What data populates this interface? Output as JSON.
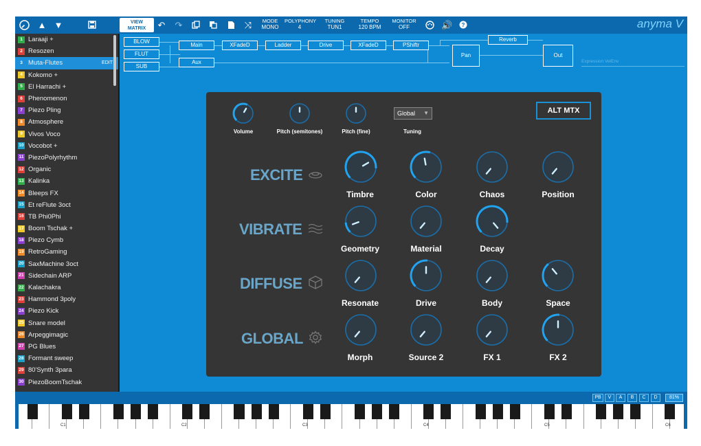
{
  "topbar": {
    "view_matrix_line1": "VIEW",
    "view_matrix_line2": "MATRIX",
    "mode_label": "MODE",
    "mode_value": "MONO",
    "polyphony_label": "POLYPHONY",
    "polyphony_value": "4",
    "tuning_label": "TUNING",
    "tuning_value": "TUN1",
    "tempo_label": "TEMPO",
    "tempo_value": "120 BPM",
    "monitor_label": "MONITOR",
    "monitor_value": "OFF",
    "logo": "anyma V"
  },
  "presets": [
    {
      "num": "1",
      "name": "Laraaji +",
      "color": "#2fae4a"
    },
    {
      "num": "2",
      "name": "Resozen",
      "color": "#e0403a"
    },
    {
      "num": "3",
      "name": "Muta-Flutes",
      "color": "#1e8fd8",
      "selected": true,
      "edit": "EDIT"
    },
    {
      "num": "4",
      "name": "Kokomo +",
      "color": "#f0c828"
    },
    {
      "num": "5",
      "name": "El Harrachi +",
      "color": "#2fae4a"
    },
    {
      "num": "6",
      "name": "Phenomenon",
      "color": "#e0403a"
    },
    {
      "num": "7",
      "name": "Piezo Pling",
      "color": "#8a3fd0"
    },
    {
      "num": "8",
      "name": "Atmosphere",
      "color": "#f08a28"
    },
    {
      "num": "9",
      "name": "Vivos Voco",
      "color": "#f0c828"
    },
    {
      "num": "10",
      "name": "Vocobot +",
      "color": "#1aa0c8"
    },
    {
      "num": "11",
      "name": "PiezoPolyrhythm",
      "color": "#8a3fd0"
    },
    {
      "num": "12",
      "name": "Organic",
      "color": "#e0403a"
    },
    {
      "num": "13",
      "name": "Kalinka",
      "color": "#2fae4a"
    },
    {
      "num": "14",
      "name": "Bleeps FX",
      "color": "#f08a28"
    },
    {
      "num": "15",
      "name": "Et reFlute 3oct",
      "color": "#1aa0c8"
    },
    {
      "num": "16",
      "name": "TB Phi0Phi",
      "color": "#e0403a"
    },
    {
      "num": "17",
      "name": "Boom Tschak +",
      "color": "#f0c828"
    },
    {
      "num": "18",
      "name": "Piezo Cymb",
      "color": "#8a3fd0"
    },
    {
      "num": "19",
      "name": "RetroGaming",
      "color": "#f08a28"
    },
    {
      "num": "20",
      "name": "SaxMachine 3oct",
      "color": "#1aa0c8"
    },
    {
      "num": "21",
      "name": "Sidechain ARP",
      "color": "#d03fb0"
    },
    {
      "num": "22",
      "name": "Kalachakra",
      "color": "#2fae4a"
    },
    {
      "num": "23",
      "name": "Hammond 3poly",
      "color": "#e0403a"
    },
    {
      "num": "24",
      "name": "Piezo Kick",
      "color": "#8a3fd0"
    },
    {
      "num": "25",
      "name": "Snare model",
      "color": "#f0c828"
    },
    {
      "num": "26",
      "name": "Arpeggimagic",
      "color": "#f08a28"
    },
    {
      "num": "27",
      "name": "PG Blues",
      "color": "#d03fb0"
    },
    {
      "num": "28",
      "name": "Formant sweep",
      "color": "#1aa0c8"
    },
    {
      "num": "29",
      "name": "80'Synth 3para",
      "color": "#e0403a"
    },
    {
      "num": "30",
      "name": "PiezoBoomTschak",
      "color": "#8a3fd0"
    }
  ],
  "chain": {
    "blow": "BLOW",
    "flut": "FLUT",
    "sub": "SUB",
    "main": "Main",
    "aux": "Aux",
    "xfade1": "XFadeD",
    "ladder": "Ladder",
    "drive": "Drive",
    "xfade2": "XFadeD",
    "pshift": "PShiftr",
    "reverb": "Reverb",
    "pan": "Pan",
    "out": "Out",
    "expression": "Expression VelEnv"
  },
  "panel": {
    "volume": "Volume",
    "pitch_semitones": "Pitch (semitones)",
    "pitch_fine": "Pitch (fine)",
    "tuning": "Tuning",
    "tuning_select": "Global",
    "alt_mtx": "ALT MTX",
    "sections": {
      "excite": "EXCITE",
      "vibrate": "VIBRATE",
      "diffuse": "DIFFUSE",
      "global": "GLOBAL"
    },
    "knobs": {
      "timbre": "Timbre",
      "color": "Color",
      "chaos": "Chaos",
      "position": "Position",
      "geometry": "Geometry",
      "material": "Material",
      "decay": "Decay",
      "resonate": "Resonate",
      "drive": "Drive",
      "body": "Body",
      "space": "Space",
      "morph": "Morph",
      "source2": "Source 2",
      "fx1": "FX 1",
      "fx2": "FX 2"
    }
  },
  "bottom": {
    "pb": "PB",
    "v": "V",
    "a": "A",
    "b": "B",
    "c": "C",
    "d": "D",
    "zoom": "81%"
  },
  "keyboard": {
    "c1": "C1",
    "c2": "C2",
    "c3": "C3",
    "c4": "C4",
    "c5": "C5",
    "c6": "C6"
  }
}
